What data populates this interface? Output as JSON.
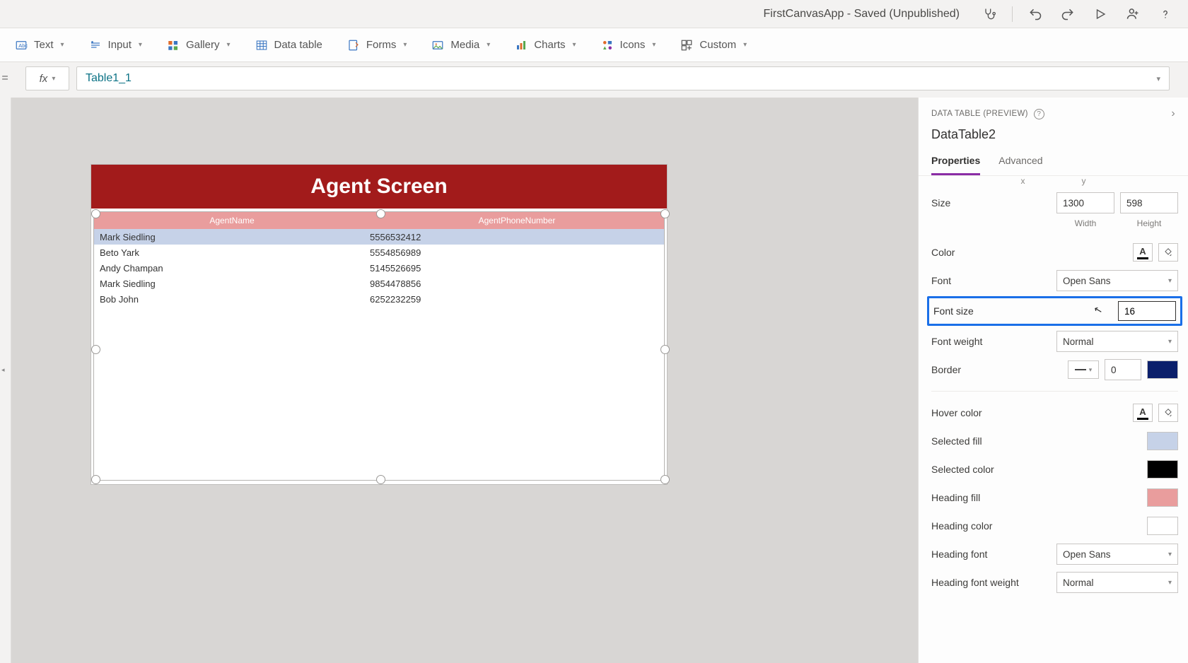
{
  "titlebar": {
    "title": "FirstCanvasApp - Saved (Unpublished)"
  },
  "ribbon": {
    "text": "Text",
    "input": "Input",
    "gallery": "Gallery",
    "datatable": "Data table",
    "forms": "Forms",
    "media": "Media",
    "charts": "Charts",
    "icons": "Icons",
    "custom": "Custom"
  },
  "formula": {
    "value": "Table1_1"
  },
  "canvas": {
    "header": "Agent Screen",
    "columns": {
      "name": "AgentName",
      "phone": "AgentPhoneNumber"
    },
    "rows": [
      {
        "name": "Mark Siedling",
        "phone": "5556532412"
      },
      {
        "name": "Beto Yark",
        "phone": "5554856989"
      },
      {
        "name": "Andy Champan",
        "phone": "5145526695"
      },
      {
        "name": "Mark Siedling",
        "phone": "9854478856"
      },
      {
        "name": "Bob John",
        "phone": "6252232259"
      }
    ]
  },
  "props": {
    "crumb": "DATA TABLE (PREVIEW)",
    "name": "DataTable2",
    "tabs": {
      "properties": "Properties",
      "advanced": "Advanced"
    },
    "size_label": "Size",
    "width": "1300",
    "height": "598",
    "width_label": "Width",
    "height_label": "Height",
    "ghost_x": "x",
    "ghost_y": "y",
    "color_label": "Color",
    "font_label": "Font",
    "font_value": "Open Sans",
    "fontsize_label": "Font size",
    "fontsize_value": "16",
    "fontweight_label": "Font weight",
    "fontweight_value": "Normal",
    "border_label": "Border",
    "border_value": "0",
    "hover_label": "Hover color",
    "selfill_label": "Selected fill",
    "selcolor_label": "Selected color",
    "headfill_label": "Heading fill",
    "headcolor_label": "Heading color",
    "headfont_label": "Heading font",
    "headfont_value": "Open Sans",
    "headfw_label": "Heading font weight",
    "headfw_value": "Normal",
    "colors": {
      "border_swatch": "#0b1f6b",
      "selected_fill": "#c6d2e8",
      "selected_color": "#000000",
      "heading_fill": "#e99d9d",
      "heading_color": "#ffffff"
    }
  }
}
